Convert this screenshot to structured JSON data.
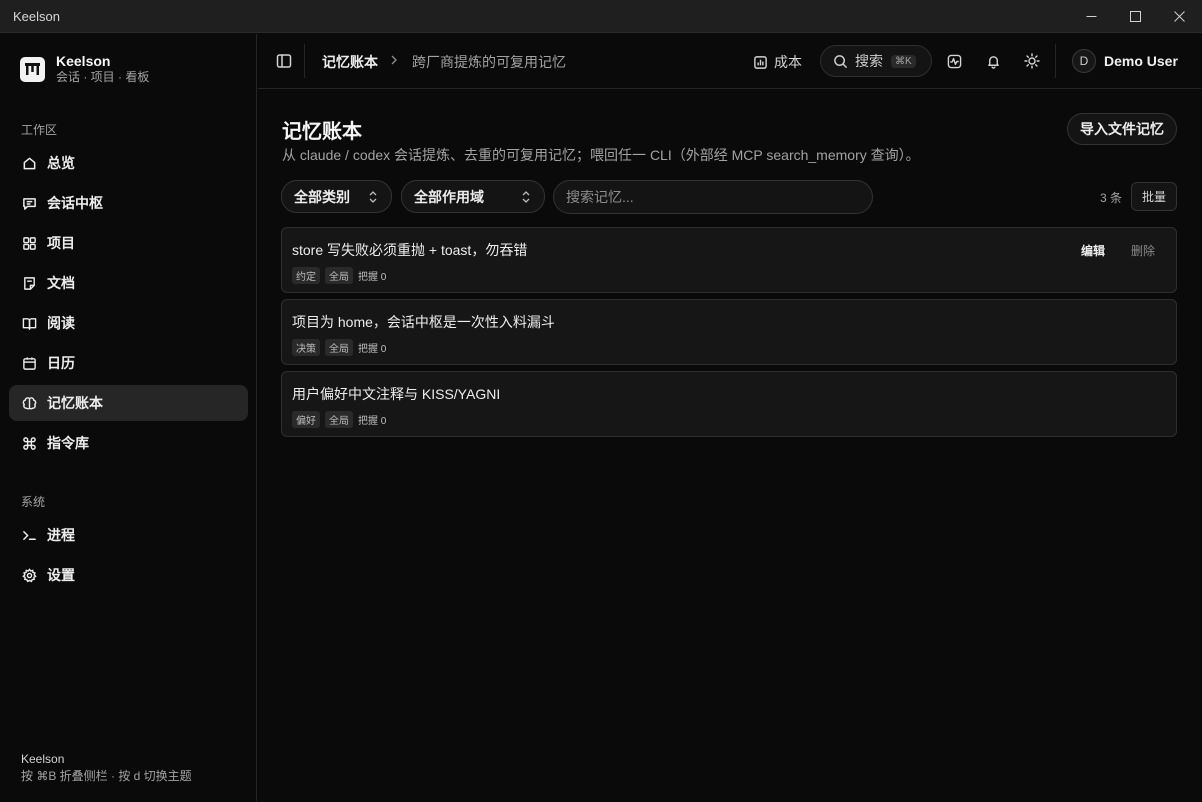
{
  "window": {
    "title": "Keelson"
  },
  "sidebar": {
    "brand_name": "Keelson",
    "brand_sub": "会话 · 项目 · 看板",
    "workspace_label": "工作区",
    "workspace_items": [
      {
        "label": "总览",
        "icon": "home-icon"
      },
      {
        "label": "会话中枢",
        "icon": "chat-icon"
      },
      {
        "label": "项目",
        "icon": "grid-icon"
      },
      {
        "label": "文档",
        "icon": "document-icon"
      },
      {
        "label": "阅读",
        "icon": "book-icon"
      },
      {
        "label": "日历",
        "icon": "calendar-icon"
      },
      {
        "label": "记忆账本",
        "icon": "brain-icon",
        "active": true
      },
      {
        "label": "指令库",
        "icon": "command-icon"
      }
    ],
    "system_label": "系统",
    "system_items": [
      {
        "label": "进程",
        "icon": "terminal-icon"
      },
      {
        "label": "设置",
        "icon": "gear-icon"
      }
    ],
    "footer_title": "Keelson",
    "footer_hint": "按 ⌘B 折叠侧栏 · 按 d 切换主题"
  },
  "header": {
    "breadcrumb_root": "记忆账本",
    "breadcrumb_current": "跨厂商提炼的可复用记忆",
    "cost_label": "成本",
    "search_label": "搜索",
    "search_shortcut": "⌘K",
    "user_initial": "D",
    "user_name": "Demo User"
  },
  "main": {
    "title": "记忆账本",
    "description": "从 claude / codex 会话提炼、去重的可复用记忆；喂回任一 CLI（外部经 MCP search_memory 查询）。",
    "import_label": "导入文件记忆",
    "filter_category": "全部类别",
    "filter_scope": "全部作用域",
    "search_placeholder": "搜索记忆...",
    "count_label": "3 条",
    "batch_label": "批量",
    "edit_label": "编辑",
    "delete_label": "删除",
    "memories": [
      {
        "title": "store 写失败必须重抛 + toast，勿吞错",
        "category": "约定",
        "scope": "全局",
        "grip": "把握 0"
      },
      {
        "title": "项目为 home，会话中枢是一次性入料漏斗",
        "category": "决策",
        "scope": "全局",
        "grip": "把握 0"
      },
      {
        "title": "用户偏好中文注释与 KISS/YAGNI",
        "category": "偏好",
        "scope": "全局",
        "grip": "把握 0"
      }
    ]
  }
}
